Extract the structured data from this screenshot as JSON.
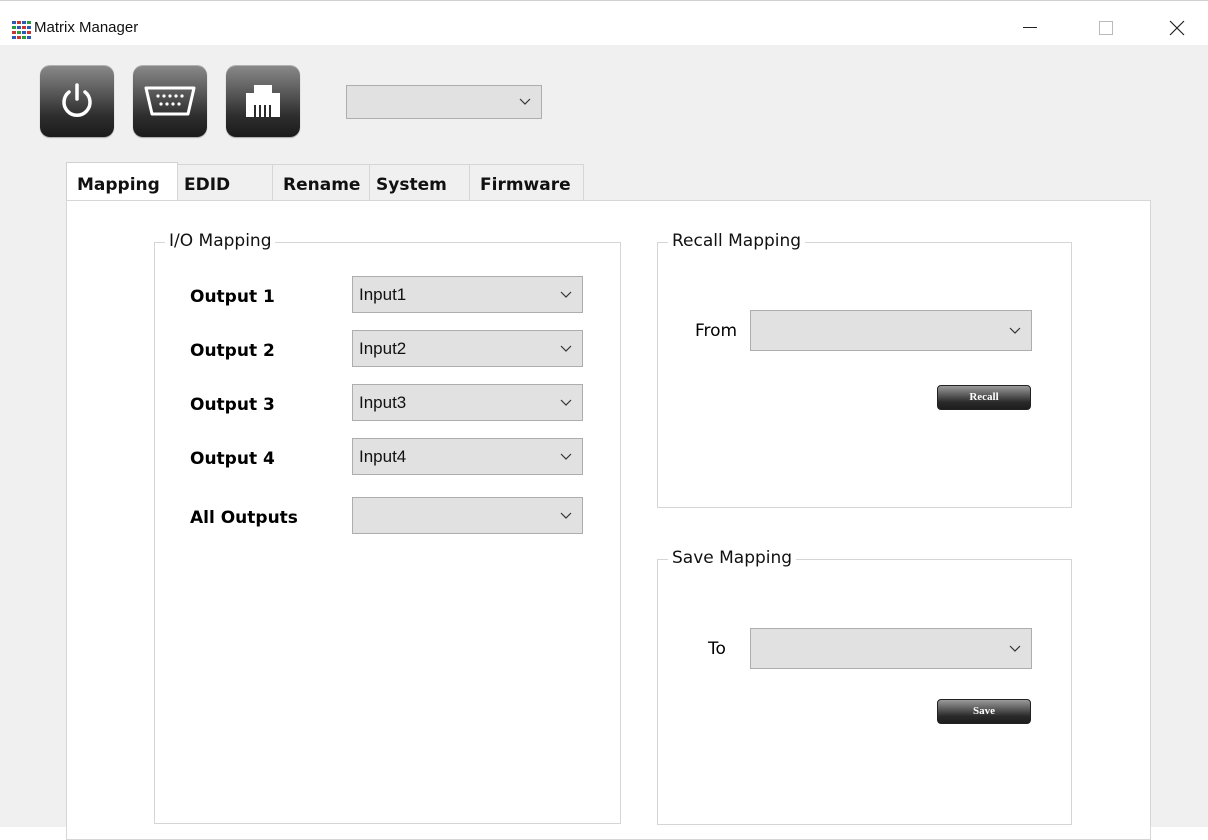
{
  "window": {
    "title": "Matrix Manager",
    "controls": [
      "minimize",
      "maximize",
      "close"
    ]
  },
  "toolbar": {
    "buttons": [
      {
        "icon": "power-icon"
      },
      {
        "icon": "serial-port-icon"
      },
      {
        "icon": "ethernet-port-icon"
      }
    ],
    "port_select_value": ""
  },
  "tabs": [
    {
      "label": "Mapping",
      "active": true
    },
    {
      "label": "EDID",
      "active": false
    },
    {
      "label": "Rename",
      "active": false
    },
    {
      "label": "System",
      "active": false
    },
    {
      "label": "Firmware",
      "active": false
    }
  ],
  "io_mapping": {
    "title": "I/O Mapping",
    "rows": [
      {
        "label": "Output 1",
        "value": "Input1"
      },
      {
        "label": "Output 2",
        "value": "Input2"
      },
      {
        "label": "Output 3",
        "value": "Input3"
      },
      {
        "label": "Output 4",
        "value": "Input4"
      },
      {
        "label": "All Outputs",
        "value": ""
      }
    ]
  },
  "recall_mapping": {
    "title": "Recall Mapping",
    "from_label": "From",
    "from_value": "",
    "button_label": "Recall"
  },
  "save_mapping": {
    "title": "Save Mapping",
    "to_label": "To",
    "to_value": "",
    "button_label": "Save"
  },
  "colors": {
    "window_bg": "#f0f0f0",
    "panel_bg": "#ffffff",
    "combo_bg": "#e1e1e1",
    "button_dark": "#1d1d1d"
  }
}
